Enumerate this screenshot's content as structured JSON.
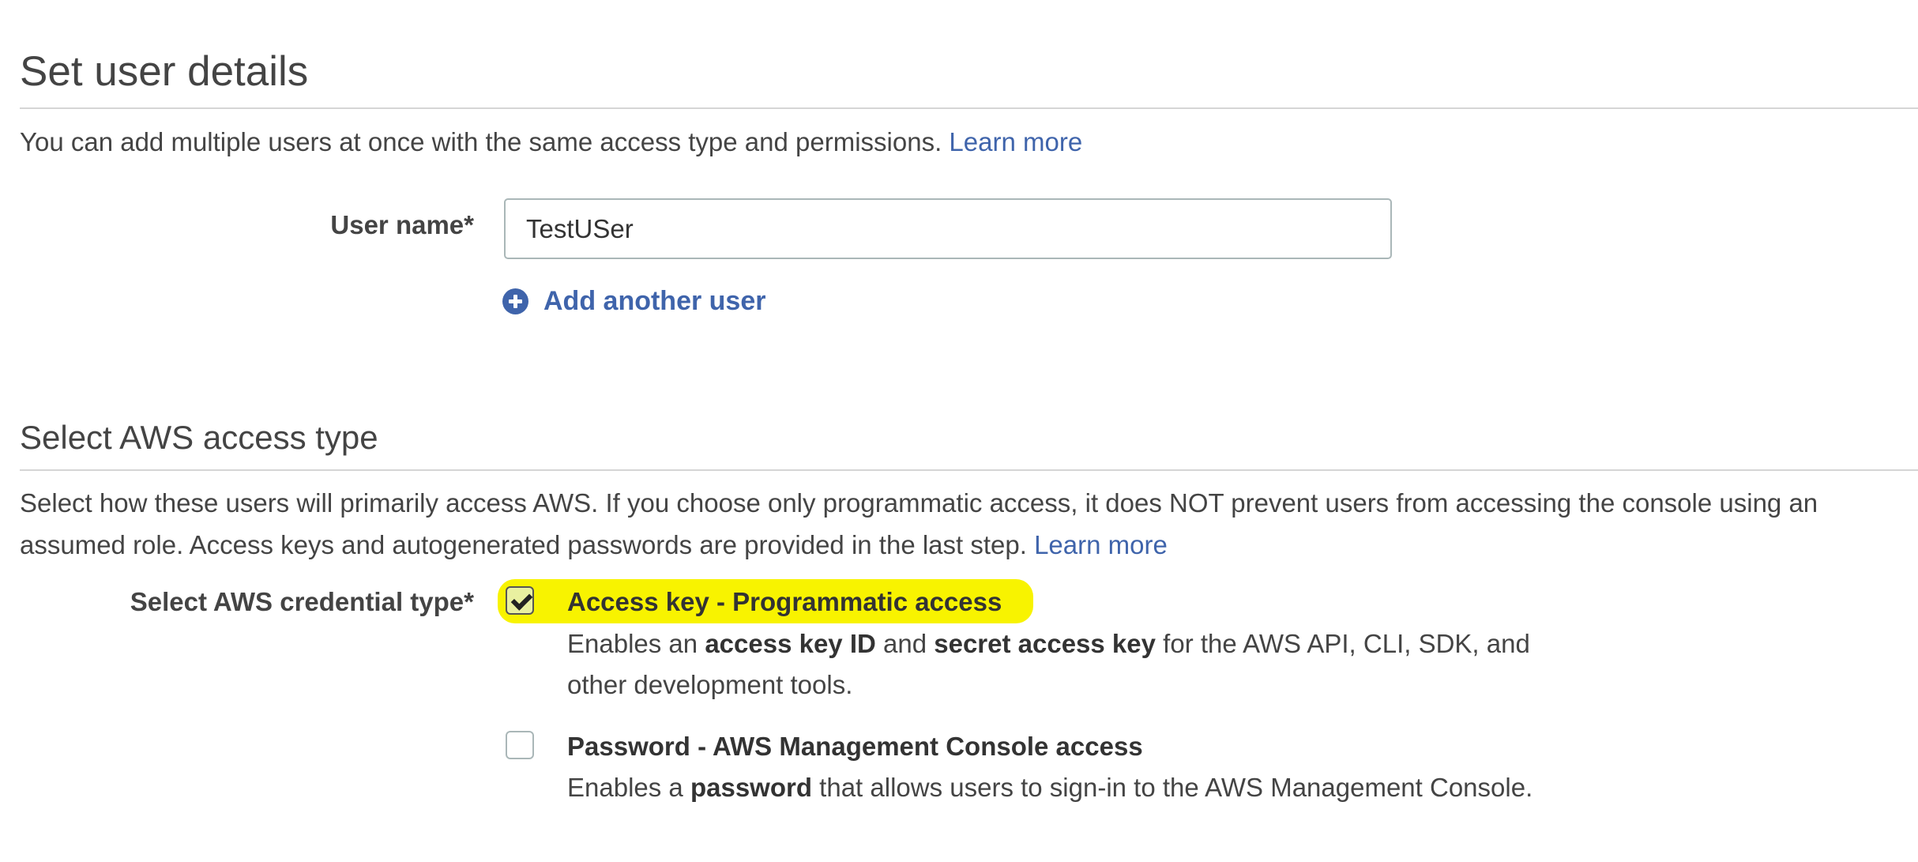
{
  "user_details": {
    "title": "Set user details",
    "description": "You can add multiple users at once with the same access type and permissions.",
    "learn_more": "Learn more",
    "user_name_label": "User name*",
    "user_name_value": "TestUSer",
    "add_another_user": "Add another user"
  },
  "access_type": {
    "title": "Select AWS access type",
    "description": "Select how these users will primarily access AWS. If you choose only programmatic access, it does NOT prevent users from accessing the console using an assumed role. Access keys and autogenerated passwords are provided in the last step.",
    "learn_more": "Learn more",
    "credential_label": "Select AWS credential type*",
    "options": [
      {
        "title": "Access key - Programmatic access",
        "checked": true,
        "highlighted": true,
        "desc_1": "Enables an ",
        "desc_bold_1": "access key ID",
        "desc_2": " and ",
        "desc_bold_2": "secret access key",
        "desc_3": " for the AWS API, CLI, SDK, and",
        "desc_4": "other development tools."
      },
      {
        "title": "Password - AWS Management Console access",
        "checked": false,
        "desc_1": "Enables a ",
        "desc_bold_1": "password",
        "desc_2": " that allows users to sign-in to the AWS Management Console."
      }
    ]
  },
  "colors": {
    "link": "#3f64ab",
    "highlight": "#f8f300",
    "rule": "#d5d5d5"
  }
}
